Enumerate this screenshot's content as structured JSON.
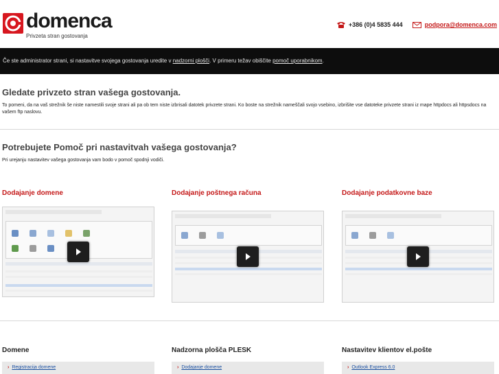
{
  "header": {
    "brand": "domenca",
    "tagline": "Privzeta stran gostovanja",
    "phone": "+386 (0)4 5835 444",
    "email": "podpora@domenca.com",
    "phone_icon": "phone-icon",
    "mail_icon": "mail-icon",
    "accent_color": "#c41818"
  },
  "notice": {
    "text_before": "Če ste administrator strani, si nastavitve svojega gostovanja uredite v ",
    "link1": "nadzorni plošči",
    "text_middle": ". V primeru težav obiščite ",
    "link2": "pomoč uporabnikom",
    "text_after": "."
  },
  "section1": {
    "title": "Gledate privzeto stran vašega gostovanja.",
    "text": "To pomeni, da na vaš strežnik še niste namestili svoje strani ali pa ob tem niste izbrisali datotek privzete strani. Ko boste na strežnik nameščali svojo vsebino, izbrišite vse datoteke privzete strani iz mape httpdocs ali httpsdocs na vašem ftp naslovu."
  },
  "section2": {
    "title": "Potrebujete Pomoč pri nastavitvah vašega gostovanja?",
    "text": "Pri urejanju nastavitev vašega gostovanja vam bodo v pomoč spodnji vodiči."
  },
  "videos": [
    {
      "title": "Dodajanje domene"
    },
    {
      "title": "Dodajanje poštnega računa"
    },
    {
      "title": "Dodajanje podatkovne baze"
    }
  ],
  "bottom": [
    {
      "title": "Domene",
      "link": "Registracija domene"
    },
    {
      "title": "Nadzorna plošča PLESK",
      "link": "Dodajanje domene"
    },
    {
      "title": "Nastavitev klientov el.pošte",
      "link": "Outlook Express 6.0"
    }
  ]
}
